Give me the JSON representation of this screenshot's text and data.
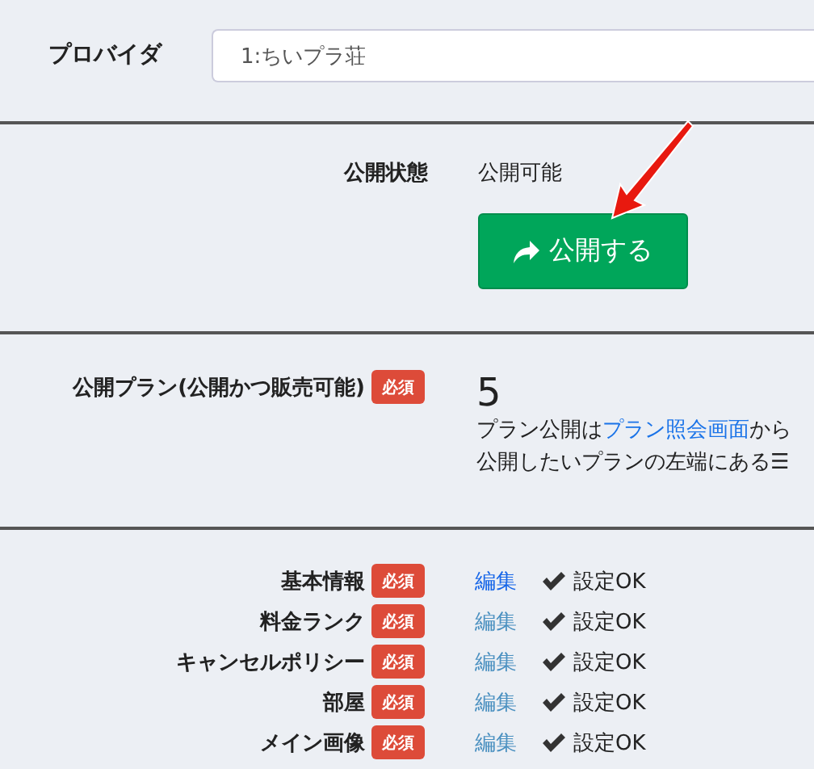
{
  "provider": {
    "label": "プロバイダ",
    "value": "1:ちいプラ荘"
  },
  "publish_status": {
    "label": "公開状態",
    "value": "公開可能",
    "button": "公開する"
  },
  "public_plans": {
    "label": "公開プラン(公開かつ販売可能)",
    "badge": "必須",
    "count": "5",
    "note_parts": [
      {
        "kind": "text",
        "text": "プラン公開は"
      },
      {
        "kind": "link",
        "text": "プラン照会画面"
      },
      {
        "kind": "text",
        "text": "から"
      }
    ],
    "note_line2": "公開したいプランの左端にある☰"
  },
  "settings": [
    {
      "label": "基本情報",
      "badge": "必須",
      "edit": "編集",
      "active": true,
      "status": "設定OK"
    },
    {
      "label": "料金ランク",
      "badge": "必須",
      "edit": "編集",
      "active": false,
      "status": "設定OK"
    },
    {
      "label": "キャンセルポリシー",
      "badge": "必須",
      "edit": "編集",
      "active": false,
      "status": "設定OK"
    },
    {
      "label": "部屋",
      "badge": "必須",
      "edit": "編集",
      "active": false,
      "status": "設定OK"
    },
    {
      "label": "メイン画像",
      "badge": "必須",
      "edit": "編集",
      "active": false,
      "status": "設定OK"
    }
  ]
}
